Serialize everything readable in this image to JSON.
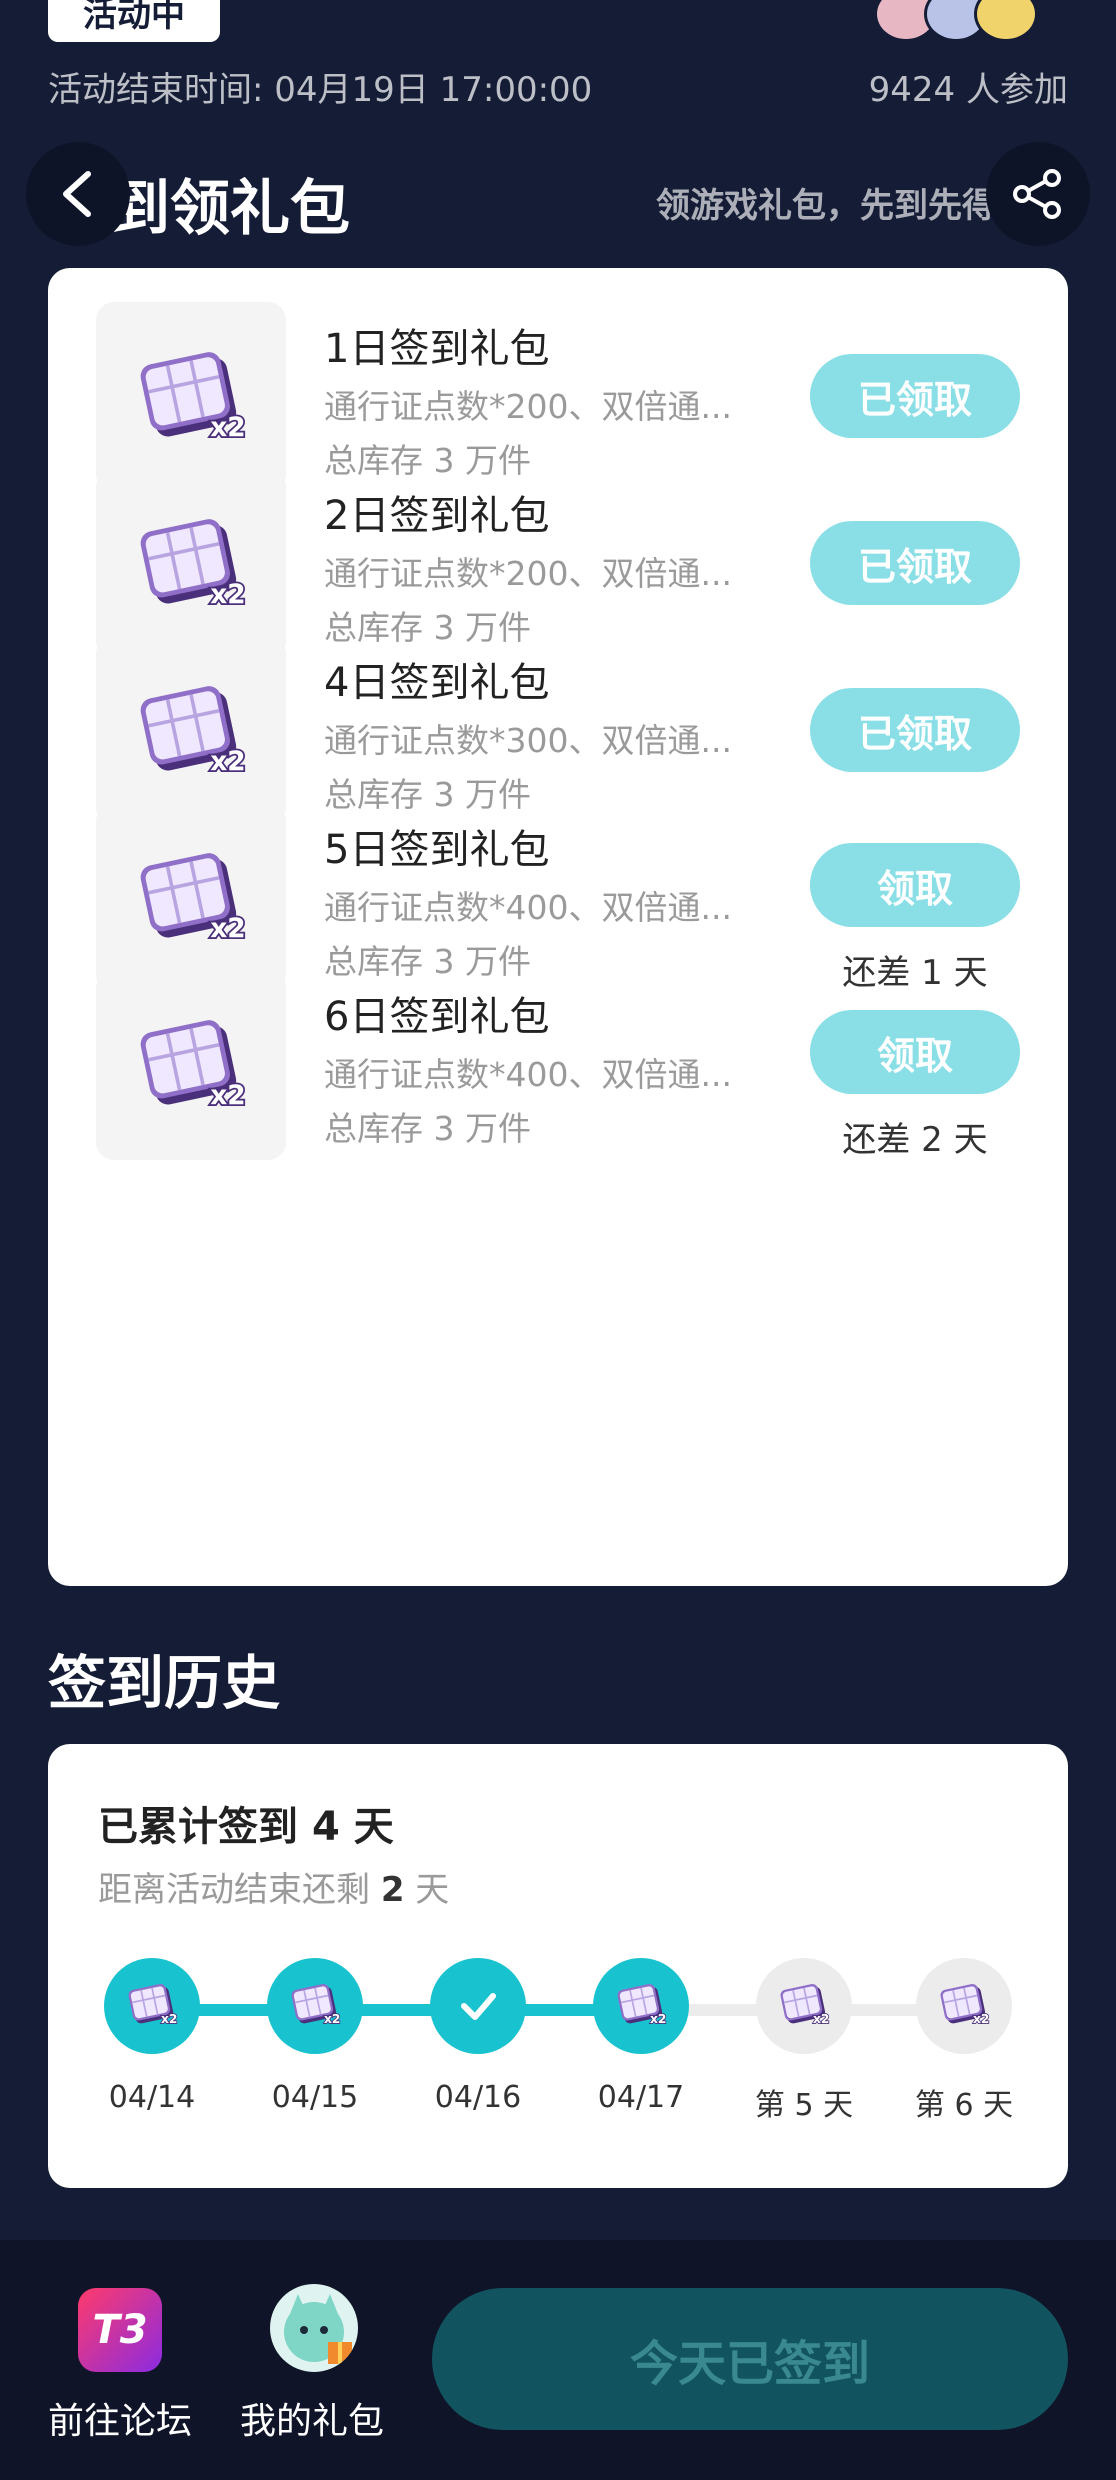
{
  "status_badge": "活动中",
  "activity": {
    "end_time": "活动结束时间: 04月19日 17:00:00",
    "participants": "9424 人参加"
  },
  "header": {
    "title": "签到领礼包",
    "subtitle": "领游戏礼包，先到先得"
  },
  "gifts": [
    {
      "name": "1日签到礼包",
      "desc": "通行证点数*200、双倍通...",
      "stock": "总库存 3 万件",
      "button": "已领取",
      "remain": ""
    },
    {
      "name": "2日签到礼包",
      "desc": "通行证点数*200、双倍通...",
      "stock": "总库存 3 万件",
      "button": "已领取",
      "remain": ""
    },
    {
      "name": "4日签到礼包",
      "desc": "通行证点数*300、双倍通...",
      "stock": "总库存 3 万件",
      "button": "已领取",
      "remain": ""
    },
    {
      "name": "5日签到礼包",
      "desc": "通行证点数*400、双倍通...",
      "stock": "总库存 3 万件",
      "button": "领取",
      "remain": "还差 1 天"
    },
    {
      "name": "6日签到礼包",
      "desc": "通行证点数*400、双倍通...",
      "stock": "总库存 3 万件",
      "button": "领取",
      "remain": "还差 2 天"
    }
  ],
  "history": {
    "title": "签到历史",
    "total_prefix": "已累计签到 ",
    "total_days": "4",
    "total_suffix": " 天",
    "left_prefix": "距离活动结束还剩 ",
    "left_days": "2",
    "left_suffix": " 天",
    "days": [
      {
        "label": "04/14",
        "done": true,
        "icon": "pass-card-icon"
      },
      {
        "label": "04/15",
        "done": true,
        "icon": "pass-card-icon"
      },
      {
        "label": "04/16",
        "done": true,
        "icon": "check-icon"
      },
      {
        "label": "04/17",
        "done": true,
        "icon": "pass-card-icon"
      },
      {
        "label": "第 5 天",
        "done": false,
        "icon": "pass-card-icon"
      },
      {
        "label": "第 6 天",
        "done": false,
        "icon": "pass-card-icon"
      }
    ]
  },
  "bottom": {
    "forum_label": "前往论坛",
    "forum_icon_text": "T3",
    "my_gifts_label": "我的礼包",
    "checkin_button": "今天已签到"
  },
  "colors": {
    "background": "#141c36",
    "accent_teal": "#19c2cf",
    "claimed_button": "#8adfe6",
    "checkin_disabled": "#11545f"
  }
}
